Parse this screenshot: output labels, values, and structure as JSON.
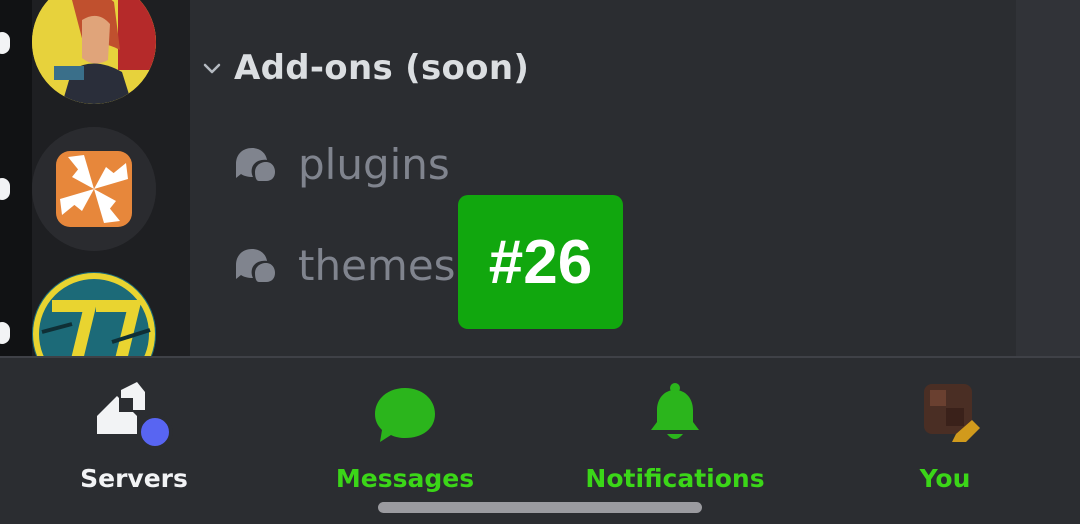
{
  "category": {
    "label": "Add-ons (soon)"
  },
  "channels": [
    {
      "label": "plugins",
      "icon": "forum-icon"
    },
    {
      "label": "themes",
      "icon": "forum-icon"
    }
  ],
  "badge": {
    "text": "#26",
    "color": "#11a70e"
  },
  "servers": [
    {
      "icon": "server-avatar-cyberpunk-character"
    },
    {
      "icon": "server-avatar-orange-pinwheel"
    },
    {
      "icon": "server-avatar-77"
    }
  ],
  "nav": {
    "tabs": [
      {
        "label": "Servers",
        "icon": "servers-icon",
        "color": "#f2f3f5"
      },
      {
        "label": "Messages",
        "icon": "messages-icon",
        "color": "#3bd618"
      },
      {
        "label": "Notifications",
        "icon": "bell-icon",
        "color": "#3bd618"
      },
      {
        "label": "You",
        "icon": "user-avatar-icon",
        "color": "#3bd618"
      }
    ]
  },
  "colors": {
    "accent_green": "#3bd618",
    "unread_dot": "#5865f2"
  }
}
